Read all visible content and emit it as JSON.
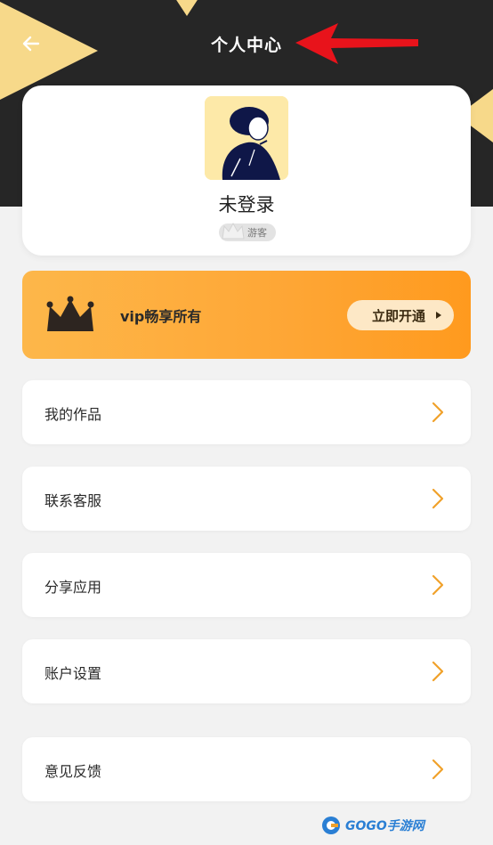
{
  "header": {
    "title": "个人中心",
    "back_icon": "arrow-left-icon"
  },
  "profile": {
    "username": "未登录",
    "badge_label": "游客",
    "avatar_icon": "user-avatar-illustration"
  },
  "vip": {
    "text": "vip畅享所有",
    "button_label": "立即开通",
    "crown_icon": "crown-icon"
  },
  "menu": {
    "items": [
      {
        "label": "我的作品"
      },
      {
        "label": "联系客服"
      },
      {
        "label": "分享应用"
      },
      {
        "label": "账户设置"
      },
      {
        "label": "意见反馈"
      }
    ]
  },
  "watermark": {
    "text": "GOGO手游网"
  },
  "colors": {
    "header_bg": "#262626",
    "accent_yellow": "#f7d98a",
    "vip_orange": "#fea635",
    "chevron": "#f0a12a",
    "annotation_red": "#e8131b"
  }
}
